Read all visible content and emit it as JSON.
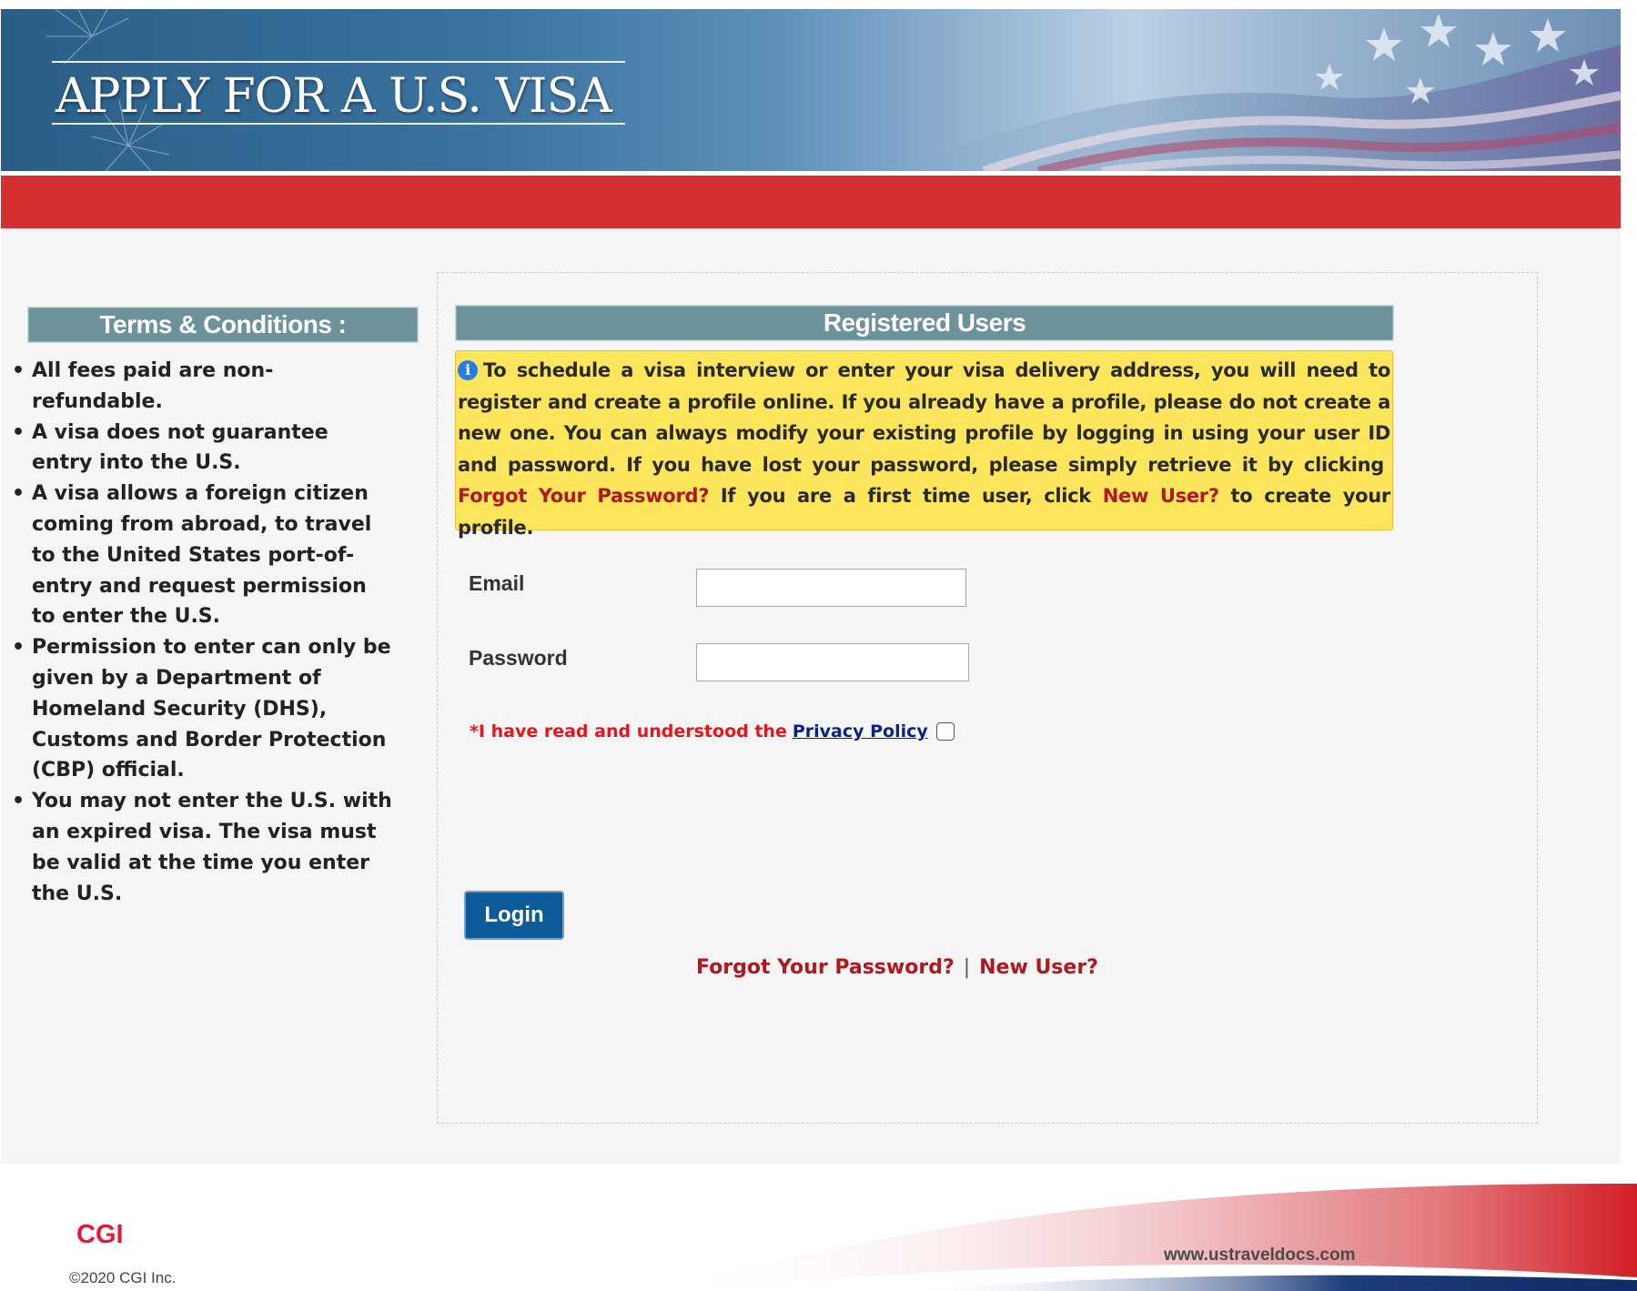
{
  "header": {
    "title": "APPLY FOR A U.S. VISA"
  },
  "terms": {
    "heading": "Terms & Conditions :",
    "items": [
      "All fees paid are non-refundable.",
      "A visa does not guarantee entry into the U.S.",
      "A visa allows a foreign citizen coming from abroad, to travel to the United States port-of-entry and request permission to enter the U.S.",
      "Permission to enter can only be given by a Department of Homeland Security (DHS), Customs and Border Protection (CBP) official.",
      "You may not enter the U.S. with an expired visa. The visa must be valid at the time you enter the U.S."
    ]
  },
  "login": {
    "heading": "Registered Users",
    "info": {
      "text_1": "To schedule a visa interview or enter your visa delivery address, you will need to register and create a profile online. If you already have a profile, please do not create a new one. You can always modify your existing profile by logging in using your user ID and password. If you have lost your password, please simply retrieve it by clicking",
      "forgot_link": "Forgot Your Password?",
      "text_2": "If you are a first time user, click",
      "new_user_link": "New User?",
      "text_3": "to create your profile."
    },
    "email_label": "Email",
    "email_value": "",
    "password_label": "Password",
    "password_value": "",
    "privacy_text": "*I have read and understood the",
    "privacy_link": "Privacy Policy",
    "privacy_checked": false,
    "login_button": "Login",
    "forgot_link": "Forgot Your Password?",
    "separator": "|",
    "new_user_link": "New User?"
  },
  "footer": {
    "logo": "CGI",
    "copyright": "©2020 CGI Inc.",
    "site": "www.ustraveldocs.com"
  },
  "colors": {
    "red_bar": "#d62f32",
    "section_header": "#6e9299",
    "info_background": "#fde55c",
    "link_red": "#b0171f",
    "login_button": "#0d5c99"
  }
}
